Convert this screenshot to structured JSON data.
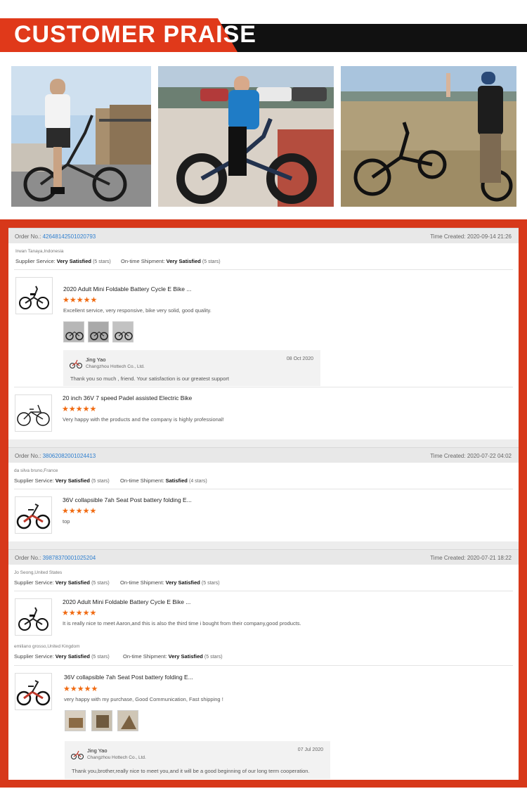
{
  "banner": {
    "title": "CUSTOMER PRAISE"
  },
  "orders": [
    {
      "order_label": "Order No.:",
      "order_number": "42648142501020793",
      "time_label": "Time Created: 2020-09-14 21:26",
      "buyer": "Irwan Tanaya,Indonesia",
      "supplier_label": "Supplier Service:",
      "supplier_value": "Very Satisfied",
      "supplier_stars": "(5 stars)",
      "shipment_label": "On-time Shipment:",
      "shipment_value": "Very Satisfied",
      "shipment_stars": "(5 stars)",
      "products": [
        {
          "title": "2020 Adult Mini Foldable Battery Cycle E Bike ...",
          "stars": "★★★★★",
          "comment": "Excellent service, very responsive, bike very solid, good quality.",
          "reply": {
            "name": "Jing Yao",
            "company": "Changzhou Hottech Co., Ltd.",
            "date": "08 Oct 2020",
            "text": "Thank you so much , friend. Your satisfaction is our greatest support"
          }
        },
        {
          "title": "20 inch 36V 7 speed Padel assisted Electric Bike",
          "stars": "★★★★★",
          "comment": "Very happy with the products and the company is highly professional!"
        }
      ]
    },
    {
      "order_label": "Order No.:",
      "order_number": "38062082001024413",
      "time_label": "Time Created: 2020-07-22 04:02",
      "buyer": "da silva bruno,France",
      "supplier_label": "Supplier Service:",
      "supplier_value": "Very Satisfied",
      "supplier_stars": "(5 stars)",
      "shipment_label": "On-time Shipment:",
      "shipment_value": "Satisfied",
      "shipment_stars": "(4 stars)",
      "products": [
        {
          "title": "36V collapsible 7ah Seat Post battery folding E...",
          "stars": "★★★★★",
          "comment": "top"
        }
      ]
    },
    {
      "order_label": "Order No.:",
      "order_number": "39878370001025204",
      "time_label": "Time Created: 2020-07-21 18:22",
      "buyer": "Jo Seong,United States",
      "supplier_label": "Supplier Service:",
      "supplier_value": "Very Satisfied",
      "supplier_stars": "(5 stars)",
      "shipment_label": "On-time Shipment:",
      "shipment_value": "Very Satisfied",
      "shipment_stars": "(5 stars)",
      "products": [
        {
          "title": "2020 Adult Mini Foldable Battery Cycle E Bike ...",
          "stars": "★★★★★",
          "comment": "It is really nice to meet Aaron,and this is also the third time i bought from their company,good products."
        }
      ],
      "buyer2": "emiliano grosso,United Kingdom",
      "supplier_label2": "Supplier Service:",
      "supplier_value2": "Very Satisfied",
      "supplier_stars2": "(5 stars)",
      "shipment_label2": "On-time Shipment:",
      "shipment_value2": "Very Satisfied",
      "shipment_stars2": "(5 stars)",
      "products2": [
        {
          "title": "36V collapsible 7ah Seat Post battery folding E...",
          "stars": "★★★★★",
          "comment": "very happy with my purchase, Good Communication, Fast shipping !",
          "reply": {
            "name": "Jing Yao",
            "company": "Changzhou Hottech Co., Ltd.",
            "date": "07 Jul 2020",
            "text": "Thank you,brother,really nice to meet you,and it will be a good beginning of our long term cooperation."
          }
        }
      ]
    }
  ]
}
